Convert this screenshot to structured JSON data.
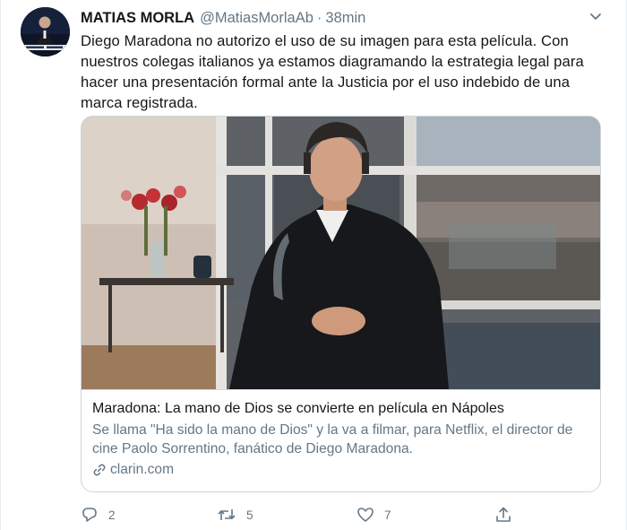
{
  "tweet": {
    "author_name": "MATIAS MORLA",
    "author_handle": "@MatiasMorlaAb",
    "separator": "·",
    "time": "38min",
    "text": "Diego Maradona no autorizo el uso de su imagen para esta película. Con nuestros colegas italianos ya estamos diagramando la estrategia legal para hacer una presentación formal ante la Justicia por el uso indebido de una marca registrada."
  },
  "card": {
    "title": "Maradona: La mano de Dios se convierte en película en Nápoles",
    "description": "Se llama \"Ha sido la mano de Dios\" y la va a filmar, para Netflix, el director de cine Paolo Sorrentino, fanático de Diego Maradona.",
    "domain": "clarin.com"
  },
  "actions": {
    "replies": "2",
    "retweets": "5",
    "likes": "7"
  },
  "icons": {
    "avatar": "avatar",
    "caret": "chevron-down-icon",
    "reply": "reply-icon",
    "retweet": "retweet-icon",
    "like": "heart-icon",
    "share": "share-icon",
    "link": "link-icon"
  },
  "colors": {
    "text": "#14171a",
    "muted": "#657786",
    "border": "#ccd6dd"
  }
}
